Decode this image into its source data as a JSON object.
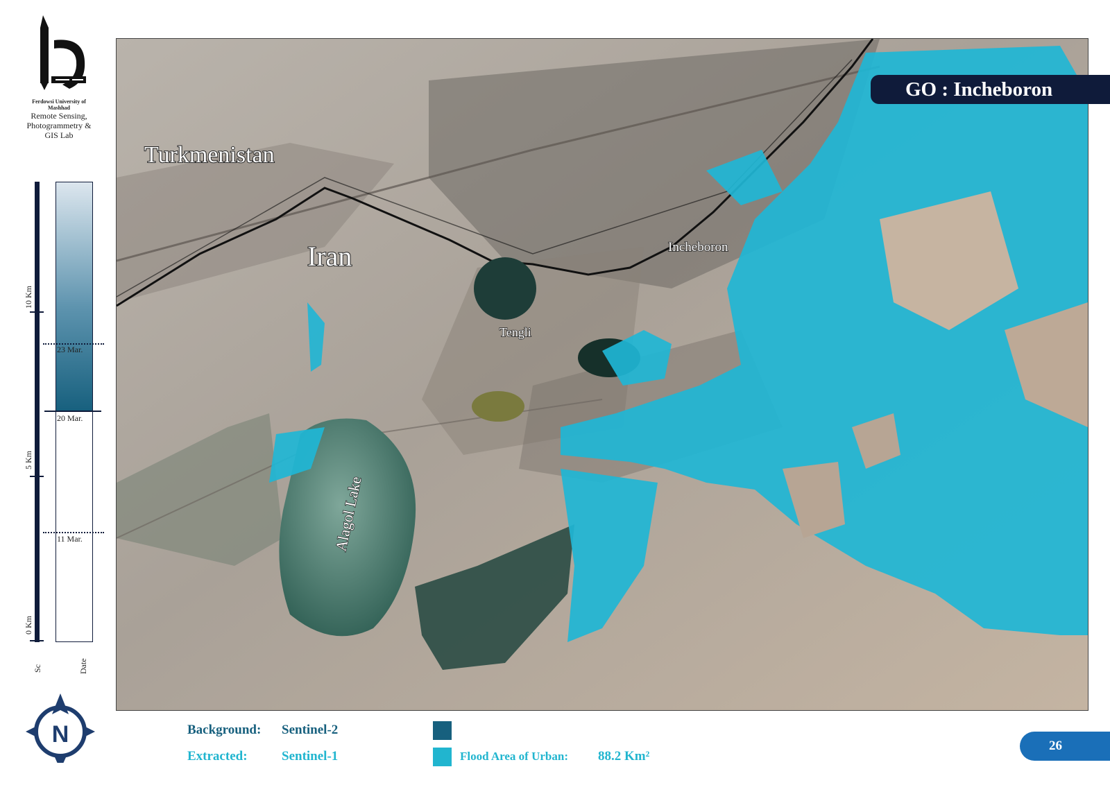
{
  "header": {
    "university": "Ferdowsi University of Mashhad",
    "lab": "Remote Sensing, Photogrammetry & GIS Lab",
    "badge": "GO : Incheboron"
  },
  "scale": {
    "labels": [
      "10 Km",
      "5 Km",
      "0 Km"
    ],
    "axis_label": "Sc"
  },
  "date_bar": {
    "dates": [
      "23 Mar.",
      "20 Mar.",
      "11 Mar."
    ],
    "axis_label": "Date"
  },
  "map": {
    "labels": {
      "country1": "Turkmenistan",
      "country2": "Iran",
      "town1": "Incheboron",
      "town2": "Tengli",
      "lake": "Alagol Lake"
    }
  },
  "legend": {
    "background_key": "Background:",
    "background_value": "Sentinel-2",
    "extracted_key": "Extracted:",
    "extracted_value": "Sentinel-1",
    "flood_label": "Flood Area of Urban:",
    "flood_value": "88.2 Km²"
  },
  "colors": {
    "dark_navy": "#0f1b3a",
    "flood_cyan": "#1fb6d5",
    "teal_dark": "#17607e",
    "legend_cyan": "#21b5cf",
    "page_blue": "#1a6fb8"
  },
  "icons": [
    "university-logo-icon",
    "compass-north-icon"
  ],
  "page_number": "26"
}
